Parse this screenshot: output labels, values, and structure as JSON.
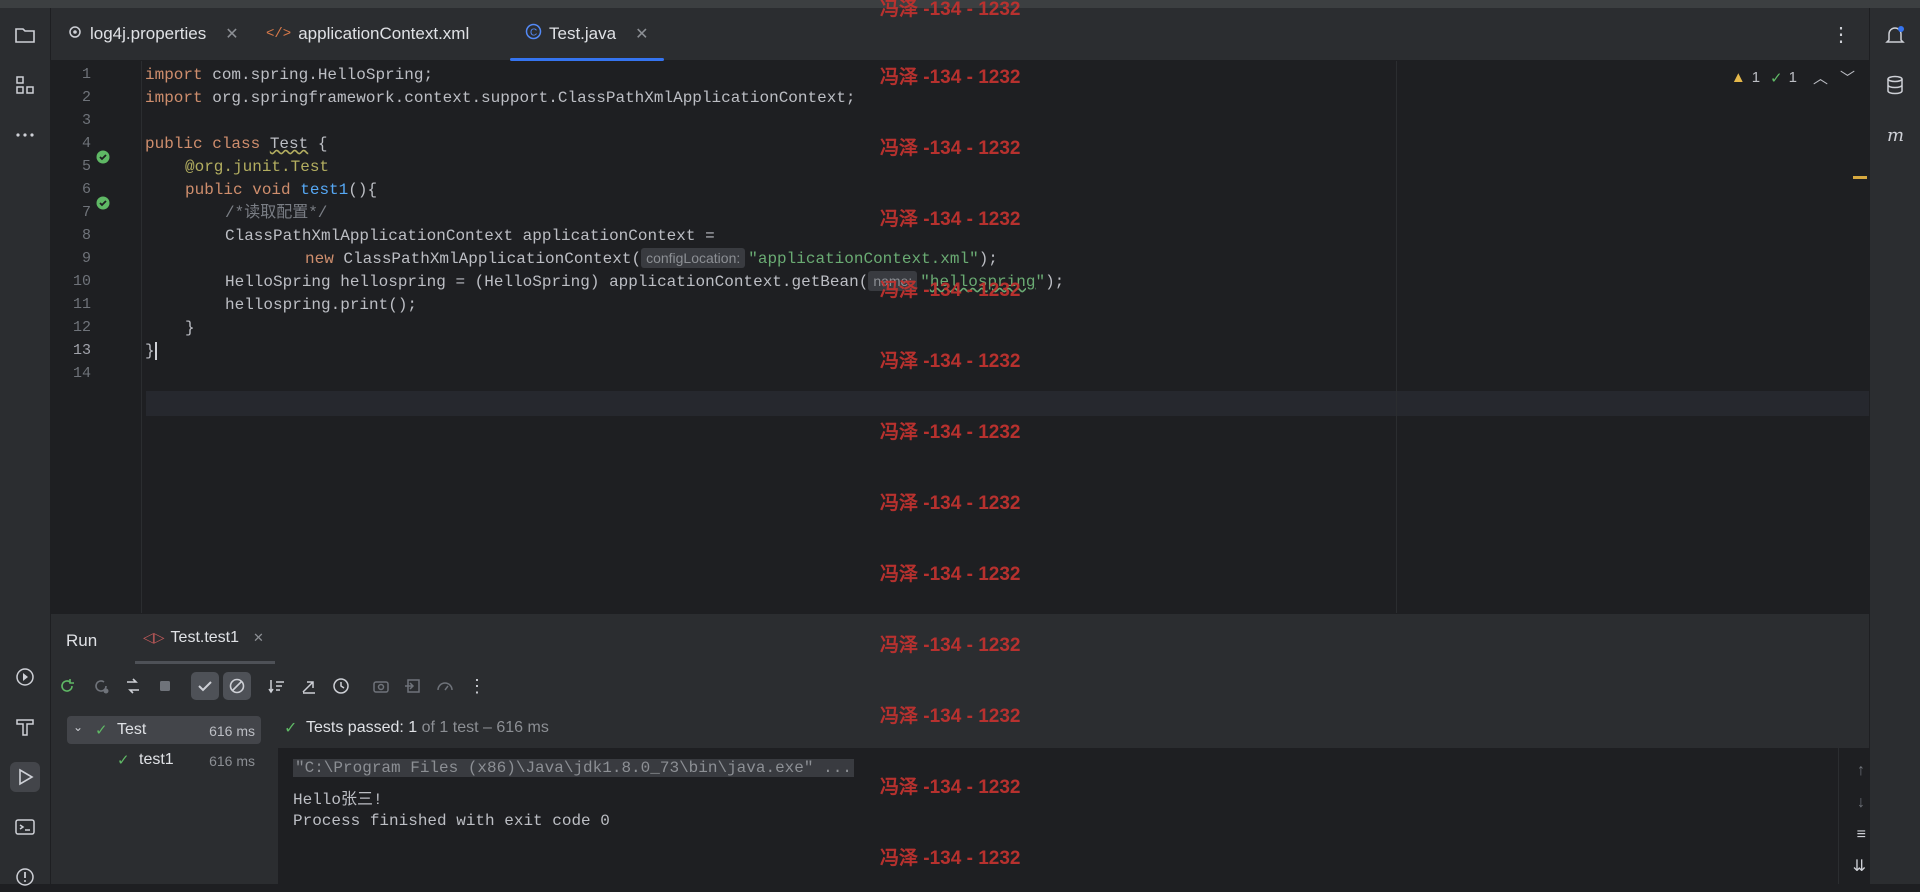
{
  "tabs": [
    {
      "label": "log4j.properties",
      "icon": "gear-icon"
    },
    {
      "label": "applicationContext.xml",
      "icon": "xml-icon"
    },
    {
      "label": "Test.java",
      "icon": "java-class-icon",
      "active": true
    }
  ],
  "editor": {
    "line_numbers": [
      "1",
      "2",
      "3",
      "4",
      "5",
      "6",
      "7",
      "8",
      "9",
      "10",
      "11",
      "12",
      "13",
      "14"
    ],
    "inspection": {
      "warnings": "1",
      "typos": "1"
    },
    "code": {
      "l1_kw": "import",
      "l1_rest": " com.spring.HelloSpring;",
      "l2_kw": "import",
      "l2_rest": " org.springframework.context.support.ClassPathXmlApplicationContext;",
      "l4_kw": "public class",
      "l4_name": "Test",
      "l4_brace": " {",
      "l5_ann": "@org.junit.",
      "l5_test": "Test",
      "l6_kw": "public void",
      "l6_fn": "test1",
      "l6_rest": "(){",
      "l7_cmt": "/*读取配置*/",
      "l8": "ClassPathXmlApplicationContext applicationContext =",
      "l9_kw": "new",
      "l9_cls": " ClassPathXmlApplicationContext(",
      "l9_hint": "configLocation:",
      "l9_str": "\"applicationContext.xml\"",
      "l9_end": ");",
      "l10_a": "HelloSpring hellospring = (HelloSpring) applicationContext.getBean(",
      "l10_hint": "name:",
      "l10_str_q1": "\"",
      "l10_str": "hellospring",
      "l10_str_q2": "\"",
      "l10_end": ");",
      "l11": "hellospring.print();",
      "l12": "}",
      "l13": "}"
    }
  },
  "watermark": "冯泽 -134 - 1232",
  "run_panel": {
    "title": "Run",
    "tab_label": "Test.test1",
    "tree": [
      {
        "label": "Test",
        "time": "616 ms"
      },
      {
        "label": "test1",
        "time": "616 ms"
      }
    ],
    "status_prefix": "Tests passed:",
    "status_count": "1",
    "status_suffix": "of 1 test – 616 ms",
    "console": [
      "\"C:\\Program Files (x86)\\Java\\jdk1.8.0_73\\bin\\java.exe\" ...",
      "Hello张三!",
      "Process finished with exit code 0"
    ]
  }
}
